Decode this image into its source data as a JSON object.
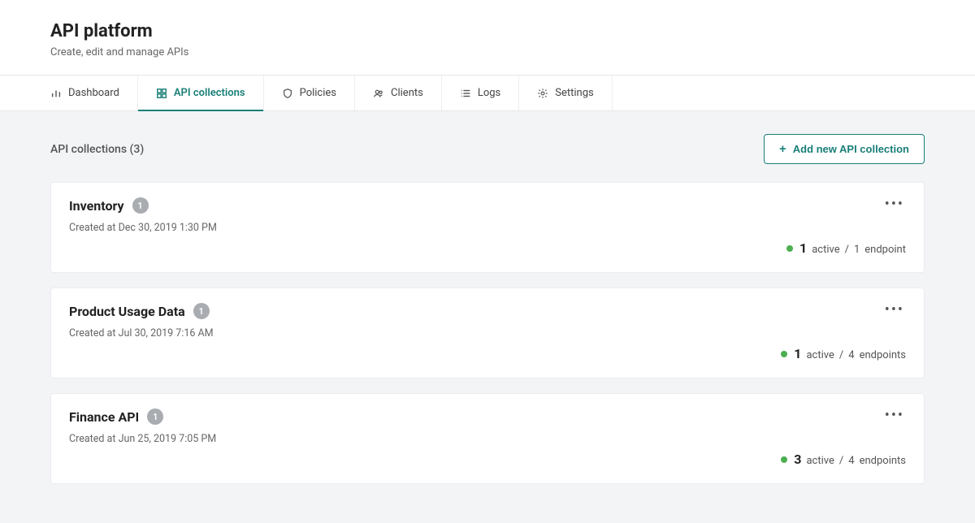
{
  "header": {
    "title": "API platform",
    "subtitle": "Create, edit and manage APIs"
  },
  "tabs": [
    {
      "key": "dashboard",
      "label": "Dashboard",
      "icon": "bar-chart-icon",
      "active": false
    },
    {
      "key": "collections",
      "label": "API collections",
      "icon": "grid-icon",
      "active": true
    },
    {
      "key": "policies",
      "label": "Policies",
      "icon": "shield-icon",
      "active": false
    },
    {
      "key": "clients",
      "label": "Clients",
      "icon": "users-icon",
      "active": false
    },
    {
      "key": "logs",
      "label": "Logs",
      "icon": "list-icon",
      "active": false
    },
    {
      "key": "settings",
      "label": "Settings",
      "icon": "gear-icon",
      "active": false
    }
  ],
  "list": {
    "title_prefix": "API collections",
    "count": 3
  },
  "add_button": {
    "label": "Add new API collection"
  },
  "collections": [
    {
      "name": "Inventory",
      "badge": "1",
      "created_prefix": "Created at",
      "created_at": "Dec 30, 2019 1:30 PM",
      "status_color": "#4caf50",
      "active_count": "1",
      "active_label": "active",
      "endpoint_count": "1",
      "endpoint_label": "endpoint"
    },
    {
      "name": "Product Usage Data",
      "badge": "1",
      "created_prefix": "Created at",
      "created_at": "Jul 30, 2019 7:16 AM",
      "status_color": "#4caf50",
      "active_count": "1",
      "active_label": "active",
      "endpoint_count": "4",
      "endpoint_label": "endpoints"
    },
    {
      "name": "Finance API",
      "badge": "1",
      "created_prefix": "Created at",
      "created_at": "Jun 25, 2019 7:05 PM",
      "status_color": "#4caf50",
      "active_count": "3",
      "active_label": "active",
      "endpoint_count": "4",
      "endpoint_label": "endpoints"
    }
  ],
  "colors": {
    "accent": "#1a7f78",
    "status_ok": "#4caf50"
  }
}
